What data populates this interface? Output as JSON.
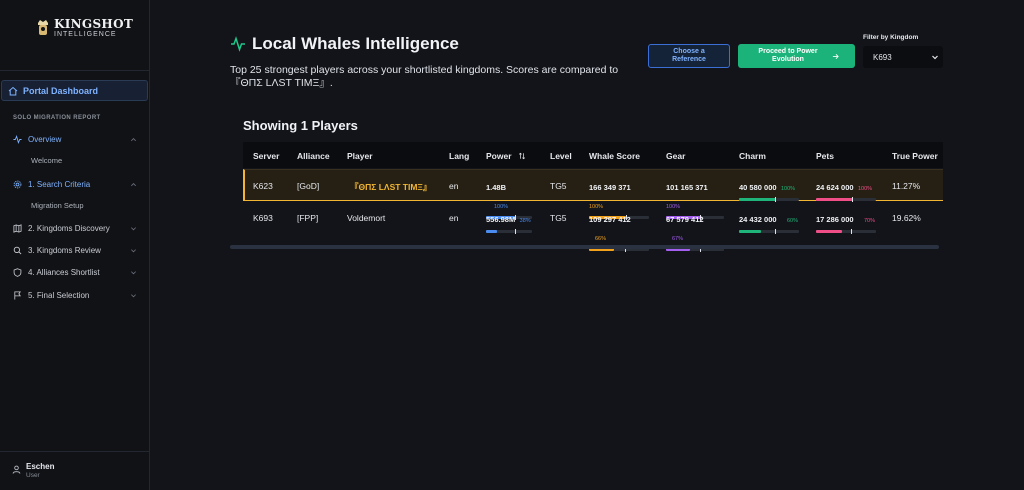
{
  "brand": {
    "title": "KINGSHOT",
    "subtitle": "INTELLIGENCE"
  },
  "sidebar": {
    "portal_label": "Portal Dashboard",
    "section_label": "SOLO MIGRATION REPORT",
    "items": [
      {
        "label": "Overview"
      },
      {
        "label": "Welcome"
      },
      {
        "label": "1. Search Criteria"
      },
      {
        "label": "Migration Setup"
      },
      {
        "label": "2. Kingdoms Discovery"
      },
      {
        "label": "3. Kingdoms Review"
      },
      {
        "label": "4. Alliances Shortlist"
      },
      {
        "label": "5. Final Selection"
      }
    ],
    "user": {
      "name": "Eschen",
      "role": "User"
    }
  },
  "header": {
    "title": "Local Whales Intelligence",
    "subtitle": "Top 25 strongest players across your shortlisted kingdoms. Scores are compared to 『ΘΠΣ LΛST TIMΞ』.",
    "choose_reference": "Choose a Reference",
    "proceed": "Proceed to Power Evolution",
    "filter_label": "Filter by Kingdom",
    "filter_value": "K693"
  },
  "table": {
    "showing": "Showing 1 Players",
    "headers": [
      "Server",
      "Alliance",
      "Player",
      "Lang",
      "Power",
      "Level",
      "Whale Score",
      "Gear",
      "Charm",
      "Pets",
      "True Power"
    ],
    "rows": [
      {
        "server": "K623",
        "alliance": "[GoD]",
        "player": "『ΘΠΣ LΛST TIMΞ』",
        "lang": "en",
        "power": "1.48B",
        "power_pct": "100%",
        "power_frac": 1.0,
        "level": "TG5",
        "whale": "166 349 371",
        "whale_pct": "100%",
        "whale_frac": 1.0,
        "gear": "101 165 371",
        "gear_pct": "100%",
        "gear_frac": 1.0,
        "charm": "40 580 000",
        "charm_pct": "100%",
        "charm_frac": 1.0,
        "pets": "24 624 000",
        "pets_pct": "100%",
        "pets_frac": 1.0,
        "true_power": "11.27%"
      },
      {
        "server": "K693",
        "alliance": "[FPP]",
        "player": "Voldemort",
        "lang": "en",
        "power": "556.98M",
        "power_pct": "38%",
        "power_frac": 0.38,
        "level": "TG5",
        "whale": "109 297 412",
        "whale_pct": "66%",
        "whale_frac": 0.66,
        "gear": "67 579 412",
        "gear_pct": "67%",
        "gear_frac": 0.67,
        "charm": "24 432 000",
        "charm_pct": "60%",
        "charm_frac": 0.6,
        "pets": "17 286 000",
        "pets_pct": "70%",
        "pets_frac": 0.7,
        "true_power": "19.62%"
      }
    ]
  },
  "colors": {
    "accent": "#7fb2ff",
    "proceed": "#1bb37a",
    "highlight": "#f2b632",
    "power": "#4a8cf0",
    "whale": "#f2a21b",
    "gear": "#a45ef0",
    "charm": "#1fb57a",
    "pets": "#ef4f86"
  }
}
